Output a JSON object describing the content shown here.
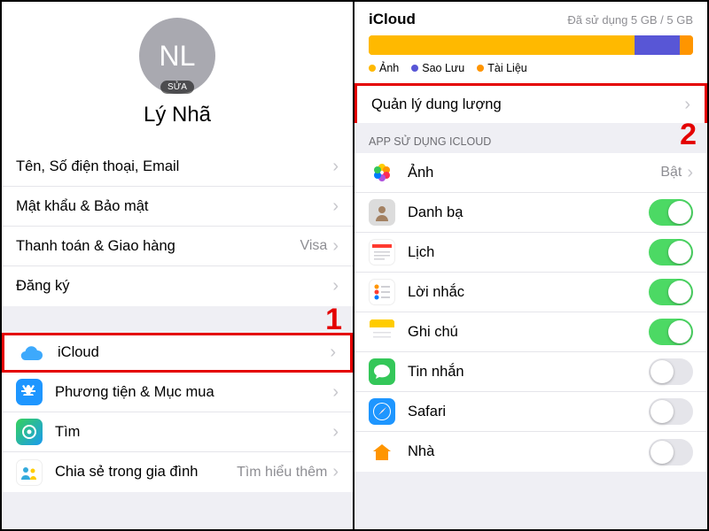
{
  "left": {
    "avatar_initials": "NL",
    "avatar_edit": "SỬA",
    "profile_name": "Lý Nhã",
    "group1": [
      {
        "label": "Tên, Số điện thoại, Email",
        "value": ""
      },
      {
        "label": "Mật khẩu & Bảo mật",
        "value": ""
      },
      {
        "label": "Thanh toán & Giao hàng",
        "value": "Visa"
      },
      {
        "label": "Đăng ký",
        "value": ""
      }
    ],
    "group2": [
      {
        "label": "iCloud",
        "icon": "cloud"
      },
      {
        "label": "Phương tiện & Mục mua",
        "icon": "appstore"
      },
      {
        "label": "Tìm",
        "icon": "findmy"
      },
      {
        "label": "Chia sẻ trong gia đình",
        "icon": "family",
        "value": "Tìm hiểu thêm"
      }
    ],
    "annotation_number": "1"
  },
  "right": {
    "title": "iCloud",
    "usage": "Đã sử dụng 5 GB / 5 GB",
    "bar_segments": [
      {
        "color": "#ffb900",
        "pct": 82
      },
      {
        "color": "#5856d6",
        "pct": 14
      },
      {
        "color": "#ff9500",
        "pct": 4
      }
    ],
    "legend": [
      {
        "color": "#ffb900",
        "label": "Ảnh"
      },
      {
        "color": "#5856d6",
        "label": "Sao Lưu"
      },
      {
        "color": "#ff9500",
        "label": "Tài Liệu"
      }
    ],
    "manage_row": {
      "label": "Quản lý dung lượng"
    },
    "group_header": "APP SỬ DỤNG ICLOUD",
    "apps": [
      {
        "label": "Ảnh",
        "icon": "photos",
        "status_text": "Bật"
      },
      {
        "label": "Danh bạ",
        "icon": "contacts",
        "toggle": true
      },
      {
        "label": "Lịch",
        "icon": "calendar",
        "toggle": true
      },
      {
        "label": "Lời nhắc",
        "icon": "reminders",
        "toggle": true
      },
      {
        "label": "Ghi chú",
        "icon": "notes",
        "toggle": true
      },
      {
        "label": "Tin nhắn",
        "icon": "messages",
        "toggle": false
      },
      {
        "label": "Safari",
        "icon": "safari",
        "toggle": false
      },
      {
        "label": "Nhà",
        "icon": "home",
        "toggle": false
      }
    ],
    "annotation_number": "2"
  }
}
